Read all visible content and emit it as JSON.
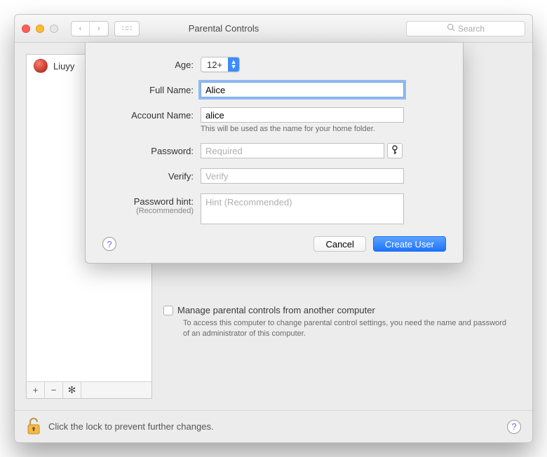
{
  "window": {
    "title": "Parental Controls",
    "search_placeholder": "Search"
  },
  "sidebar": {
    "items": [
      {
        "label": "Liuyy"
      }
    ]
  },
  "main": {
    "manage_label": "Manage parental controls from another computer",
    "manage_help": "To access this computer to change parental control settings, you need the name and password of an administrator of this computer."
  },
  "footer": {
    "lock_text": "Click the lock to prevent further changes."
  },
  "sheet": {
    "labels": {
      "age": "Age:",
      "full_name": "Full Name:",
      "account_name": "Account Name:",
      "password": "Password:",
      "verify": "Verify:",
      "hint": "Password hint:",
      "hint_sub": "(Recommended)"
    },
    "values": {
      "age_selected": "12+",
      "full_name": "Alice",
      "account_name": "alice",
      "password": "",
      "verify": "",
      "hint": ""
    },
    "placeholders": {
      "password": "Required",
      "verify": "Verify",
      "hint": "Hint (Recommended)"
    },
    "hints": {
      "account_name": "This will be used as the name for your home folder."
    },
    "buttons": {
      "cancel": "Cancel",
      "create": "Create User"
    }
  }
}
